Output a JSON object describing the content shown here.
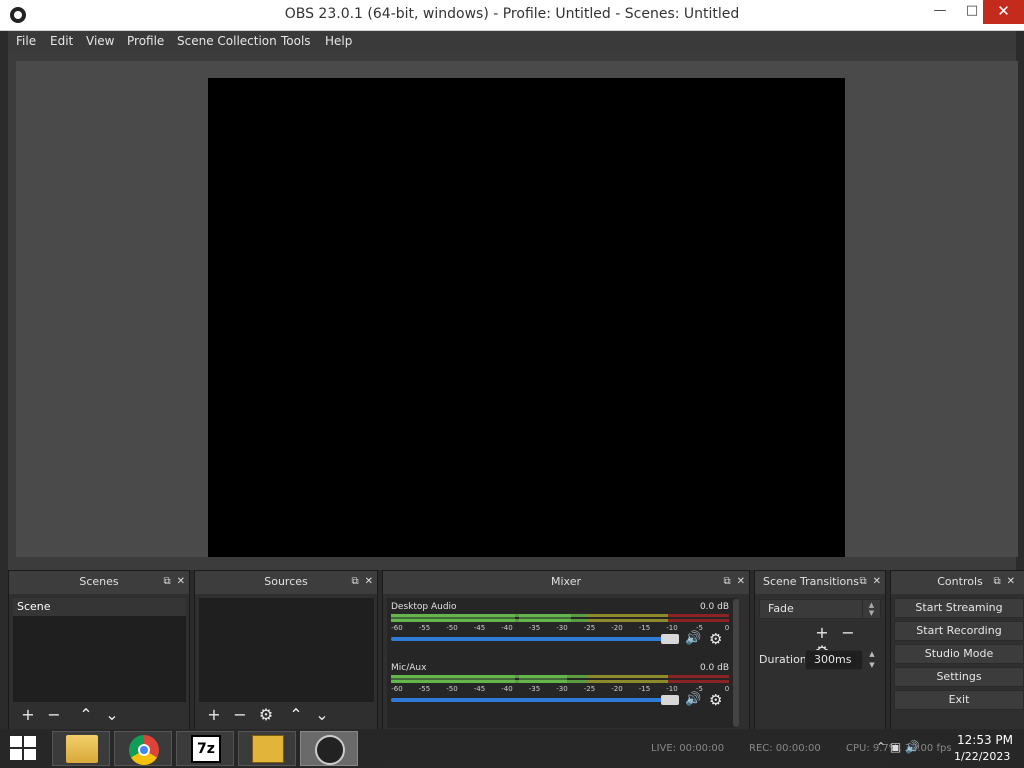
{
  "window": {
    "title": "OBS 23.0.1 (64-bit, windows) - Profile: Untitled - Scenes: Untitled",
    "minimize": "—",
    "maximize": "□",
    "close": "✕"
  },
  "menu": [
    "File",
    "Edit",
    "View",
    "Profile",
    "Scene Collection",
    "Tools",
    "Help"
  ],
  "docks": {
    "scenes": {
      "title": "Scenes",
      "items": [
        "Scene"
      ]
    },
    "sources": {
      "title": "Sources"
    },
    "mixer": {
      "title": "Mixer",
      "tracks": [
        {
          "name": "Desktop Audio",
          "db": "0.0 dB"
        },
        {
          "name": "Mic/Aux",
          "db": "0.0 dB"
        }
      ],
      "ticks": [
        "-60",
        "-55",
        "-50",
        "-45",
        "-40",
        "-35",
        "-30",
        "-25",
        "-20",
        "-15",
        "-10",
        "-5",
        "0"
      ]
    },
    "transitions": {
      "title": "Scene Transitions",
      "selected": "Fade",
      "duration_label": "Duration",
      "duration_value": "300ms"
    },
    "controls": {
      "title": "Controls",
      "buttons": [
        "Start Streaming",
        "Start Recording",
        "Studio Mode",
        "Settings",
        "Exit"
      ]
    }
  },
  "status": {
    "live": "LIVE: 00:00:00",
    "rec": "REC: 00:00:00",
    "cpu": "CPU: 9.7%, 30.00 fps"
  },
  "clock": {
    "time": "12:53 PM",
    "date": "1/22/2023"
  },
  "taskbar": {
    "apps": [
      "file-explorer",
      "chrome",
      "7zip",
      "notepad",
      "obs"
    ]
  },
  "colors": {
    "accent": "#2f7bd8",
    "meter_green": "#5a9c3f",
    "meter_yellow": "#8c8a2a",
    "meter_red": "#8a2424"
  }
}
